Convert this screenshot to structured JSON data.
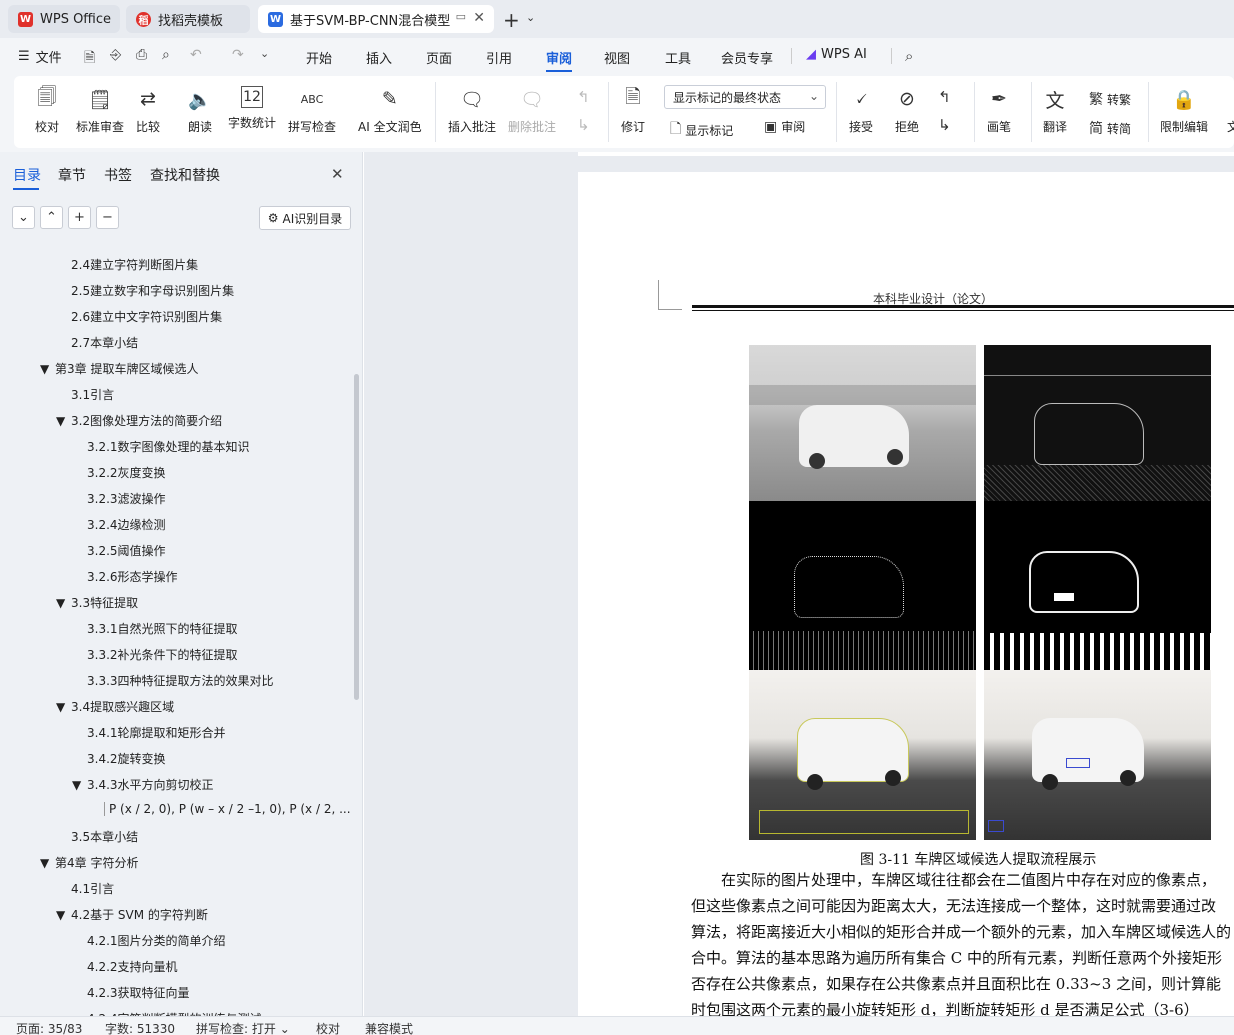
{
  "tabs": [
    {
      "label": "WPS Office",
      "icon": "wps-logo-icon"
    },
    {
      "label": "找稻壳模板",
      "icon": "docer-icon"
    },
    {
      "label": "基于SVM-BP-CNN混合模型",
      "icon": "writer-doc-icon"
    }
  ],
  "menu": {
    "file": "文件",
    "items": [
      "开始",
      "插入",
      "页面",
      "引用",
      "审阅",
      "视图",
      "工具",
      "会员专享"
    ],
    "active": "审阅",
    "wps_ai": "WPS AI"
  },
  "ribbon": {
    "proofread": "校对",
    "standard_review": "标准审查",
    "compare": "比较",
    "read_aloud": "朗读",
    "word_count": "字数统计",
    "spell_check": "拼写检查",
    "ai_polish": "AI 全文润色",
    "insert_comment": "插入批注",
    "delete_comment": "删除批注",
    "track_changes": "修订",
    "markup_state": "显示标记的最终状态",
    "show_markup": "显示标记",
    "review": "审阅",
    "accept": "接受",
    "reject": "拒绝",
    "pen": "画笔",
    "translate": "翻译",
    "to_traditional": "转繁",
    "to_simplified": "转简",
    "restrict_editing": "限制编辑",
    "doc_more": "文"
  },
  "nav": {
    "tabs": [
      "目录",
      "章节",
      "书签",
      "查找和替换"
    ],
    "ai_toc": "AI识别目录",
    "toc": [
      {
        "text": "2.4建立字符判断图片集",
        "level": 2,
        "toggle": ""
      },
      {
        "text": "2.5建立数字和字母识别图片集",
        "level": 2,
        "toggle": ""
      },
      {
        "text": "2.6建立中文字符识别图片集",
        "level": 2,
        "toggle": ""
      },
      {
        "text": "2.7本章小结",
        "level": 2,
        "toggle": ""
      },
      {
        "text": "第3章 提取车牌区域候选人",
        "level": 1,
        "toggle": "▼"
      },
      {
        "text": "3.1引言",
        "level": 2,
        "toggle": ""
      },
      {
        "text": "3.2图像处理方法的简要介绍",
        "level": 2,
        "toggle": "▼"
      },
      {
        "text": "3.2.1数字图像处理的基本知识",
        "level": 3,
        "toggle": ""
      },
      {
        "text": "3.2.2灰度变换",
        "level": 3,
        "toggle": ""
      },
      {
        "text": "3.2.3滤波操作",
        "level": 3,
        "toggle": ""
      },
      {
        "text": "3.2.4边缘检测",
        "level": 3,
        "toggle": ""
      },
      {
        "text": "3.2.5阈值操作",
        "level": 3,
        "toggle": ""
      },
      {
        "text": "3.2.6形态学操作",
        "level": 3,
        "toggle": ""
      },
      {
        "text": "3.3特征提取",
        "level": 2,
        "toggle": "▼"
      },
      {
        "text": "3.3.1自然光照下的特征提取",
        "level": 3,
        "toggle": ""
      },
      {
        "text": "3.3.2补光条件下的特征提取",
        "level": 3,
        "toggle": ""
      },
      {
        "text": "3.3.3四种特征提取方法的效果对比",
        "level": 3,
        "toggle": ""
      },
      {
        "text": "3.4提取感兴趣区域",
        "level": 2,
        "toggle": "▼"
      },
      {
        "text": "3.4.1轮廓提取和矩形合并",
        "level": 3,
        "toggle": ""
      },
      {
        "text": "3.4.2旋转变换",
        "level": 3,
        "toggle": ""
      },
      {
        "text": "3.4.3水平方向剪切校正",
        "level": 3,
        "toggle": "▼"
      },
      {
        "text": "P (x / 2, 0), P (w – x / 2 –1, 0), P (x / 2, ...",
        "level": 4,
        "toggle": ""
      },
      {
        "text": "3.5本章小结",
        "level": 2,
        "toggle": ""
      },
      {
        "text": "第4章 字符分析",
        "level": 1,
        "toggle": "▼"
      },
      {
        "text": "4.1引言",
        "level": 2,
        "toggle": ""
      },
      {
        "text": "4.2基于 SVM 的字符判断",
        "level": 2,
        "toggle": "▼"
      },
      {
        "text": "4.2.1图片分类的简单介绍",
        "level": 3,
        "toggle": ""
      },
      {
        "text": "4.2.2支持向量机",
        "level": 3,
        "toggle": ""
      },
      {
        "text": "4.2.3获取特征向量",
        "level": 3,
        "toggle": ""
      },
      {
        "text": "4.2.4字符判断模型的训练与测试",
        "level": 3,
        "toggle": ""
      }
    ]
  },
  "document": {
    "header": "本科毕业设计（论文）",
    "caption": "图 3-11 车牌区域候选人提取流程展示",
    "paragraph_lines": [
      "　　在实际的图片处理中，车牌区域往往都会在二值图片中存在对应的像素点，",
      "但这些像素点之间可能因为距离太大，无法连接成一个整体，这时就需要通过改",
      "算法，将距离接近大小相似的矩形合并成一个额外的元素，加入车牌区域候选人的",
      "合中。算法的基本思路为遍历所有集合 C 中的所有元素，判断任意两个外接矩形",
      "否存在公共像素点，如果存在公共像素点并且面积比在 0.33~3 之间，则计算能",
      "时包围这两个元素的最小旋转矩形 d，判断旋转矩形 d 是否满足公式（3-6）"
    ]
  },
  "status": {
    "page": "页面: 35/83",
    "words": "字数: 51330",
    "spell": "拼写检查: 打开",
    "proof": "校对",
    "compat": "兼容模式"
  },
  "colors": {
    "accent": "#1a5fd9",
    "wps_red": "#e0312b"
  }
}
